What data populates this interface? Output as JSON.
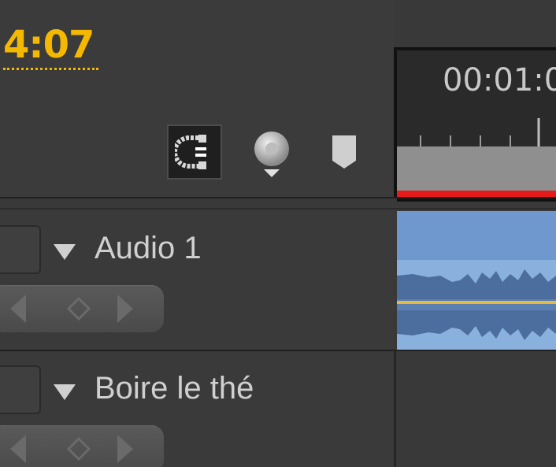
{
  "header": {
    "timecode": "4:07"
  },
  "toolbar": {
    "snap_icon": "snap-magnet-icon",
    "marker_icon": "add-marker-icon",
    "flag_icon": "marker-flag-icon"
  },
  "ruler": {
    "time_label": "00:01:0"
  },
  "tracks": [
    {
      "name": "Audio 1",
      "toggle_icon": "expand-triangle-icon",
      "keyframe_nav": [
        "previous-keyframe-icon",
        "add-keyframe-icon",
        "next-keyframe-icon"
      ]
    },
    {
      "name": "Boire le thé",
      "toggle_icon": "expand-triangle-icon",
      "keyframe_nav": [
        "previous-keyframe-icon",
        "add-keyframe-icon",
        "next-keyframe-icon"
      ]
    }
  ],
  "colors": {
    "timecode": "#f5b800",
    "playhead_bar": "#e61a1a",
    "audio_clip": "#7aa0cf",
    "volume_line": "#e8b840"
  }
}
